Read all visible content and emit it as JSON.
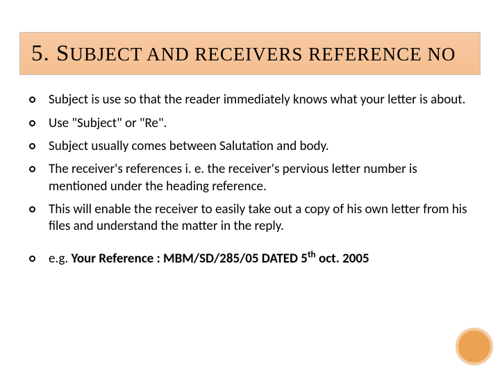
{
  "title": {
    "num_prefix": "5.   ",
    "big1": "S",
    "small1": "UBJECT",
    "mid": " AND RECEIVERS REFERENCE NO"
  },
  "bullets": {
    "b1": "Subject is use so that the reader immediately knows what your letter is about.",
    "b2": " Use \"Subject\" or \"Re\".",
    "b3": " Subject usually comes between Salutation and body.",
    "b4": "The receiver's references i. e. the receiver's pervious letter number is mentioned under the heading reference.",
    "b5": " This will enable the receiver to easily take out a copy of his own letter from his files and understand the matter in the reply."
  },
  "example": {
    "prefix": "e.g.     ",
    "bold_part1": "Your Reference : MBM/SD/285/05 DATED 5",
    "sup": "th",
    "bold_part2": " oct. 2005"
  }
}
